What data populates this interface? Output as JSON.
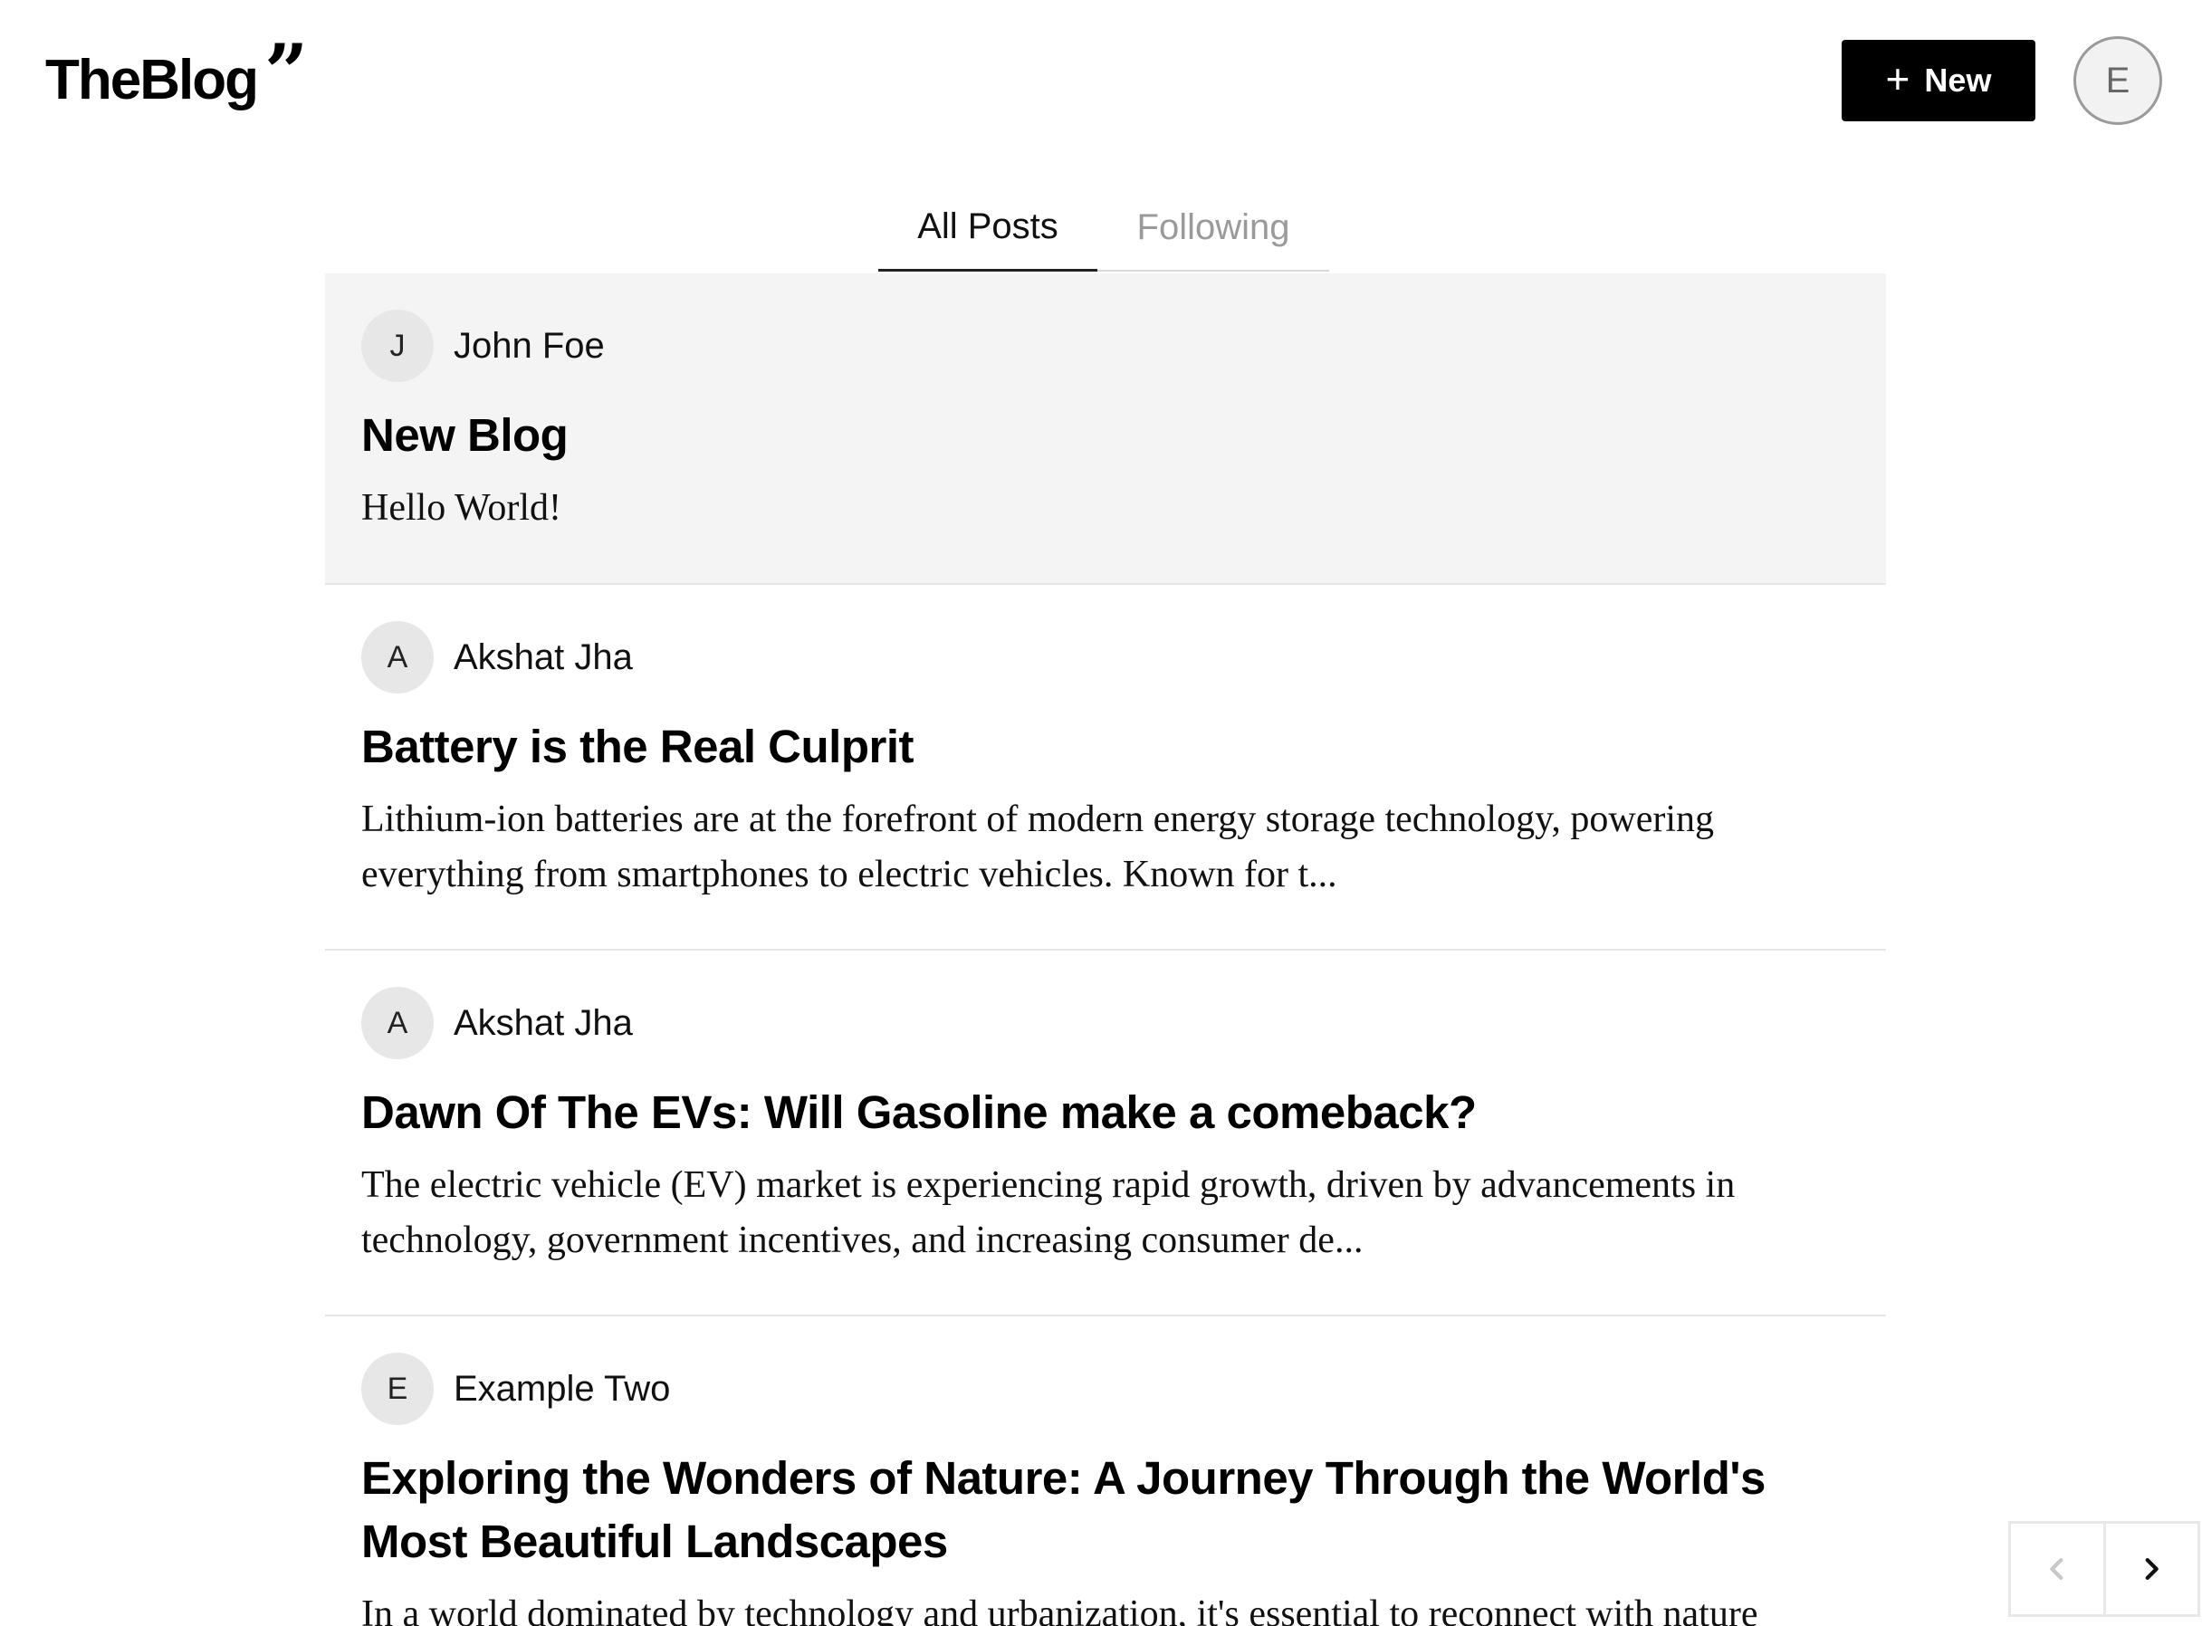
{
  "header": {
    "logo_text": "TheBlog",
    "logo_quote": "”",
    "new_button_label": "New",
    "user_avatar_initial": "E"
  },
  "tabs": [
    {
      "label": "All Posts",
      "active": true
    },
    {
      "label": "Following",
      "active": false
    }
  ],
  "posts": [
    {
      "author_initial": "J",
      "author_name": "John Foe",
      "title": "New Blog",
      "excerpt": "Hello World!"
    },
    {
      "author_initial": "A",
      "author_name": "Akshat Jha",
      "title": "Battery is the Real Culprit",
      "excerpt": "Lithium-ion batteries are at the forefront of modern energy storage technology, powering everything from smartphones to electric vehicles. Known for t..."
    },
    {
      "author_initial": "A",
      "author_name": "Akshat Jha",
      "title": "Dawn Of The EVs: Will Gasoline make a comeback?",
      "excerpt": "The electric vehicle (EV) market is experiencing rapid growth, driven by advancements in technology, government incentives, and increasing consumer de..."
    },
    {
      "author_initial": "E",
      "author_name": "Example Two",
      "title": "Exploring the Wonders of Nature: A Journey Through the World's Most Beautiful Landscapes",
      "excerpt": "In a world dominated by technology and urbanization, it's essential to reconnect with nature"
    }
  ],
  "pagination": {
    "prev_icon": "chevron-left-icon",
    "next_icon": "chevron-right-icon",
    "prev_enabled": false,
    "next_enabled": true
  },
  "colors": {
    "highlight_bg": "#f4f4f4",
    "button_bg": "#000000",
    "inactive_tab": "#9a9a9a"
  }
}
